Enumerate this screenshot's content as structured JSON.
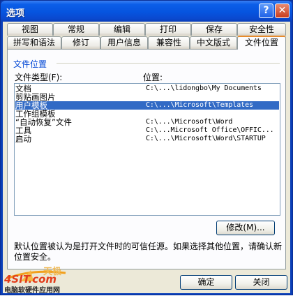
{
  "window": {
    "title": "选项",
    "help_glyph": "?",
    "close_glyph": "✕"
  },
  "tabs_row1": [
    "视图",
    "常规",
    "编辑",
    "打印",
    "保存",
    "安全性"
  ],
  "tabs_row2": [
    "拼写和语法",
    "修订",
    "用户信息",
    "兼容性",
    "中文版式",
    "文件位置"
  ],
  "active_tab": "文件位置",
  "section": {
    "title": "文件位置"
  },
  "list": {
    "col_type": "文件类型(F):",
    "col_location": "位置:",
    "rows": [
      {
        "type": "文档",
        "path": "C:\\...\\lidongbo\\My Documents"
      },
      {
        "type": "剪贴画图片",
        "path": ""
      },
      {
        "type": "用户模板",
        "path": "C:\\...\\Microsoft\\Templates",
        "selected": true
      },
      {
        "type": "工作组模板",
        "path": ""
      },
      {
        "type": "“自动恢复”文件",
        "path": "C:\\...\\Microsoft\\Word"
      },
      {
        "type": "工具",
        "path": "C:\\...Microsoft Office\\OFFIC..."
      },
      {
        "type": "启动",
        "path": "C:\\...\\Microsoft\\Word\\STARTUP"
      }
    ]
  },
  "modify_button": "修改(M)...",
  "description": "默认位置被认为是打开文件时的可信任源。如果选择其他位置，请确认新位置安全。",
  "ok_button": "确定",
  "close_button": "关闭",
  "watermark": {
    "site": "4SIT.com",
    "caption": "电脑软硬件应用网",
    "brand": "天极"
  }
}
